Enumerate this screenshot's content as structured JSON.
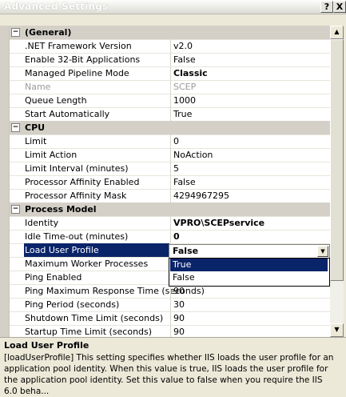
{
  "window": {
    "title": "Advanced Settings",
    "help_label": "?",
    "close_label": "X"
  },
  "categories": {
    "general": "(General)",
    "cpu": "CPU",
    "process_model": "Process Model"
  },
  "expander_symbol": "⊟",
  "rows": {
    "r1": {
      "name": ".NET Framework Version",
      "value": "v2.0"
    },
    "r2": {
      "name": "Enable 32-Bit Applications",
      "value": "False"
    },
    "r3": {
      "name": "Managed Pipeline Mode",
      "value": "Classic"
    },
    "r4": {
      "name": "Name",
      "value": "SCEP"
    },
    "r5": {
      "name": "Queue Length",
      "value": "1000"
    },
    "r6": {
      "name": "Start Automatically",
      "value": "True"
    },
    "r7": {
      "name": "Limit",
      "value": "0"
    },
    "r8": {
      "name": "Limit Action",
      "value": "NoAction"
    },
    "r9": {
      "name": "Limit Interval (minutes)",
      "value": "5"
    },
    "r10": {
      "name": "Processor Affinity Enabled",
      "value": "False"
    },
    "r11": {
      "name": "Processor Affinity Mask",
      "value": "4294967295"
    },
    "r12": {
      "name": "Identity",
      "value": "VPRO\\SCEPservice"
    },
    "r13": {
      "name": "Idle Time-out (minutes)",
      "value": "0"
    },
    "r14": {
      "name": "Load User Profile",
      "value": "False"
    },
    "r15": {
      "name": "Maximum Worker Processes",
      "value": ""
    },
    "r16": {
      "name": "Ping Enabled",
      "value": ""
    },
    "r17": {
      "name": "Ping Maximum Response Time (seconds)",
      "value": "90"
    },
    "r18": {
      "name": "Ping Period (seconds)",
      "value": "30"
    },
    "r19": {
      "name": "Shutdown Time Limit (seconds)",
      "value": "90"
    },
    "r20": {
      "name": "Startup Time Limit (seconds)",
      "value": "90"
    }
  },
  "dropdown": {
    "value": "False",
    "options": [
      "True",
      "False"
    ]
  },
  "description": {
    "title": "Load User Profile",
    "text": "[loadUserProfile] This setting specifies whether IIS loads the user profile for an application pool identity. When this value is true, IIS loads the user profile for the application pool identity. Set this value to false when you require the IIS 6.0 beha..."
  }
}
